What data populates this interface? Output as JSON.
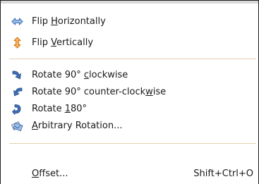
{
  "menu": {
    "items": [
      {
        "pre": "Flip ",
        "mnemonic": "H",
        "post": "orizontally",
        "icon": "flip-horizontal-icon"
      },
      {
        "pre": "Flip ",
        "mnemonic": "V",
        "post": "ertically",
        "icon": "flip-vertical-icon"
      },
      {
        "pre": "Rotate 90° ",
        "mnemonic": "c",
        "post": "lockwise",
        "icon": "rotate-cw-icon"
      },
      {
        "pre": "Rotate 90° counter-clock",
        "mnemonic": "w",
        "post": "ise",
        "icon": "rotate-ccw-icon"
      },
      {
        "pre": "Rotate ",
        "mnemonic": "1",
        "post": "80°",
        "icon": "rotate-180-icon"
      },
      {
        "pre": "",
        "mnemonic": "A",
        "post": "rbitrary Rotation...",
        "icon": "arbitrary-rotation-icon"
      },
      {
        "pre": "",
        "mnemonic": "O",
        "post": "ffset...",
        "shortcut": "Shift+Ctrl+O"
      }
    ]
  },
  "colors": {
    "separator": "#e4cfb0",
    "icon_blue": "#3f6fb5",
    "icon_light": "#9cc0e8",
    "icon_orange": "#d9771a"
  }
}
